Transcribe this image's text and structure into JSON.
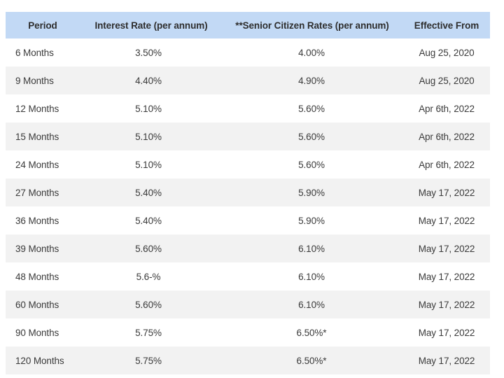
{
  "table": {
    "columns": [
      {
        "key": "period",
        "label": "Period"
      },
      {
        "key": "interest",
        "label": "Interest Rate (per annum)"
      },
      {
        "key": "senior",
        "label": "**Senior Citizen Rates (per annum)"
      },
      {
        "key": "effective",
        "label": "Effective From"
      }
    ],
    "rows": [
      {
        "period": "6 Months",
        "interest": "3.50%",
        "senior": "4.00%",
        "effective": "Aug 25, 2020"
      },
      {
        "period": "9 Months",
        "interest": "4.40%",
        "senior": "4.90%",
        "effective": "Aug 25, 2020"
      },
      {
        "period": "12 Months",
        "interest": "5.10%",
        "senior": "5.60%",
        "effective": "Apr 6th, 2022"
      },
      {
        "period": "15 Months",
        "interest": "5.10%",
        "senior": "5.60%",
        "effective": "Apr 6th, 2022"
      },
      {
        "period": "24 Months",
        "interest": "5.10%",
        "senior": "5.60%",
        "effective": "Apr 6th, 2022"
      },
      {
        "period": "27 Months",
        "interest": "5.40%",
        "senior": "5.90%",
        "effective": "May 17, 2022"
      },
      {
        "period": "36 Months",
        "interest": "5.40%",
        "senior": "5.90%",
        "effective": "May 17, 2022"
      },
      {
        "period": "39 Months",
        "interest": "5.60%",
        "senior": "6.10%",
        "effective": "May 17, 2022"
      },
      {
        "period": "48 Months",
        "interest": "5.6-%",
        "senior": "6.10%",
        "effective": "May 17, 2022"
      },
      {
        "period": "60 Months",
        "interest": "5.60%",
        "senior": "6.10%",
        "effective": "May 17, 2022"
      },
      {
        "period": "90 Months",
        "interest": "5.75%",
        "senior": "6.50%*",
        "effective": "May 17, 2022"
      },
      {
        "period": "120 Months",
        "interest": "5.75%",
        "senior": "6.50%*",
        "effective": "May 17, 2022"
      }
    ]
  },
  "colors": {
    "header_background": "#c2d9f5",
    "row_background": "#ffffff",
    "row_background_striped": "#f2f2f2",
    "header_text": "#2e2e2e",
    "body_text": "#3a3a3a"
  }
}
